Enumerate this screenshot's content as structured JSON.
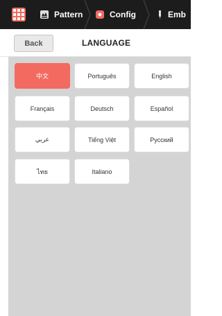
{
  "tabs": {
    "pattern_label": "Pattern",
    "config_label": "Config",
    "emb_label": "Emb"
  },
  "header": {
    "back_label": "Back",
    "title": "LANGUAGE"
  },
  "languages": [
    {
      "label": "中文",
      "selected": true
    },
    {
      "label": "Português",
      "selected": false
    },
    {
      "label": "English",
      "selected": false
    },
    {
      "label": "Français",
      "selected": false
    },
    {
      "label": "Deutsch",
      "selected": false
    },
    {
      "label": "Español",
      "selected": false
    },
    {
      "label": "عربي",
      "selected": false
    },
    {
      "label": "Tiếng Việt",
      "selected": false
    },
    {
      "label": "Русский",
      "selected": false
    },
    {
      "label": "ไทย",
      "selected": false
    },
    {
      "label": "Italiano",
      "selected": false
    }
  ],
  "colors": {
    "accent": "#f26a60",
    "tabbar": "#1c1c1c",
    "content_bg": "#d4d4d4"
  }
}
